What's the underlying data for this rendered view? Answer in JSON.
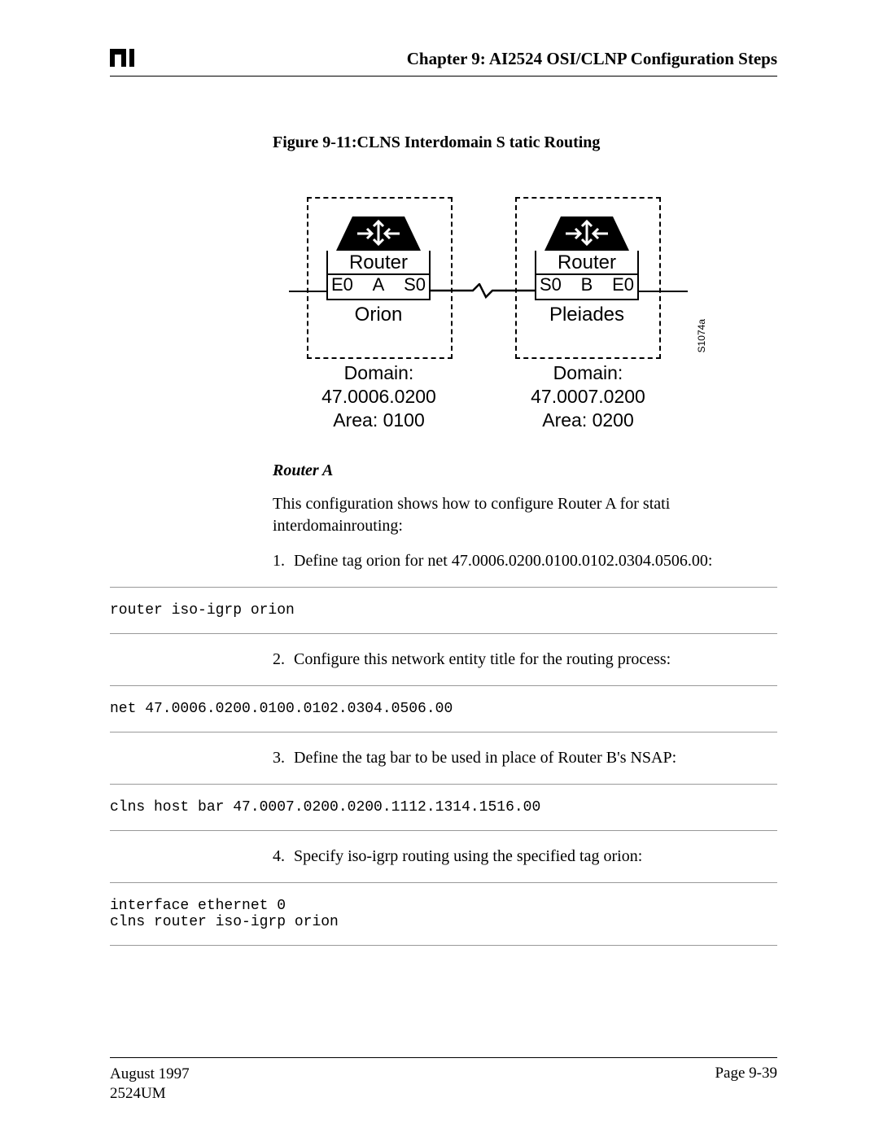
{
  "header": {
    "chapter": "Chapter 9: AI2524 OSI/CLNP Configuration Steps"
  },
  "figure": {
    "caption": "Figure 9-11:CLNS Interdomain S tatic Routing",
    "routerA": {
      "name": "Router",
      "id": "A",
      "left_port": "E0",
      "right_port": "S0",
      "net": "Orion",
      "domain": "Domain: 47.0006.0200",
      "area": "Area: 0100"
    },
    "routerB": {
      "name": "Router",
      "id": "B",
      "left_port": "S0",
      "right_port": "E0",
      "net": "Pleiades",
      "domain": "Domain: 47.0007.0200",
      "area": "Area: 0200"
    },
    "side_id": "S1074a"
  },
  "section": {
    "heading": "Router A",
    "intro": "This configuration shows how to configure Router A for stati interdomainrouting:",
    "steps": [
      {
        "num": "1.",
        "text": "Define tag orion for net 47.0006.0200.0100.0102.0304.0506.00:"
      },
      {
        "num": "2.",
        "text": "Configure this network entity title for the routing process:"
      },
      {
        "num": "3.",
        "text": "Define the tag bar to be used in place of Router B's NSAP:"
      },
      {
        "num": "4.",
        "text": "Specify iso-igrp routing using the specified tag orion:"
      }
    ],
    "code": [
      "router iso-igrp orion",
      "net 47.0006.0200.0100.0102.0304.0506.00",
      "clns host bar 47.0007.0200.0200.1112.1314.1516.00",
      "interface ethernet 0\nclns router iso-igrp orion"
    ]
  },
  "footer": {
    "date": "August 1997",
    "doc": "2524UM",
    "page": "Page 9-39"
  }
}
